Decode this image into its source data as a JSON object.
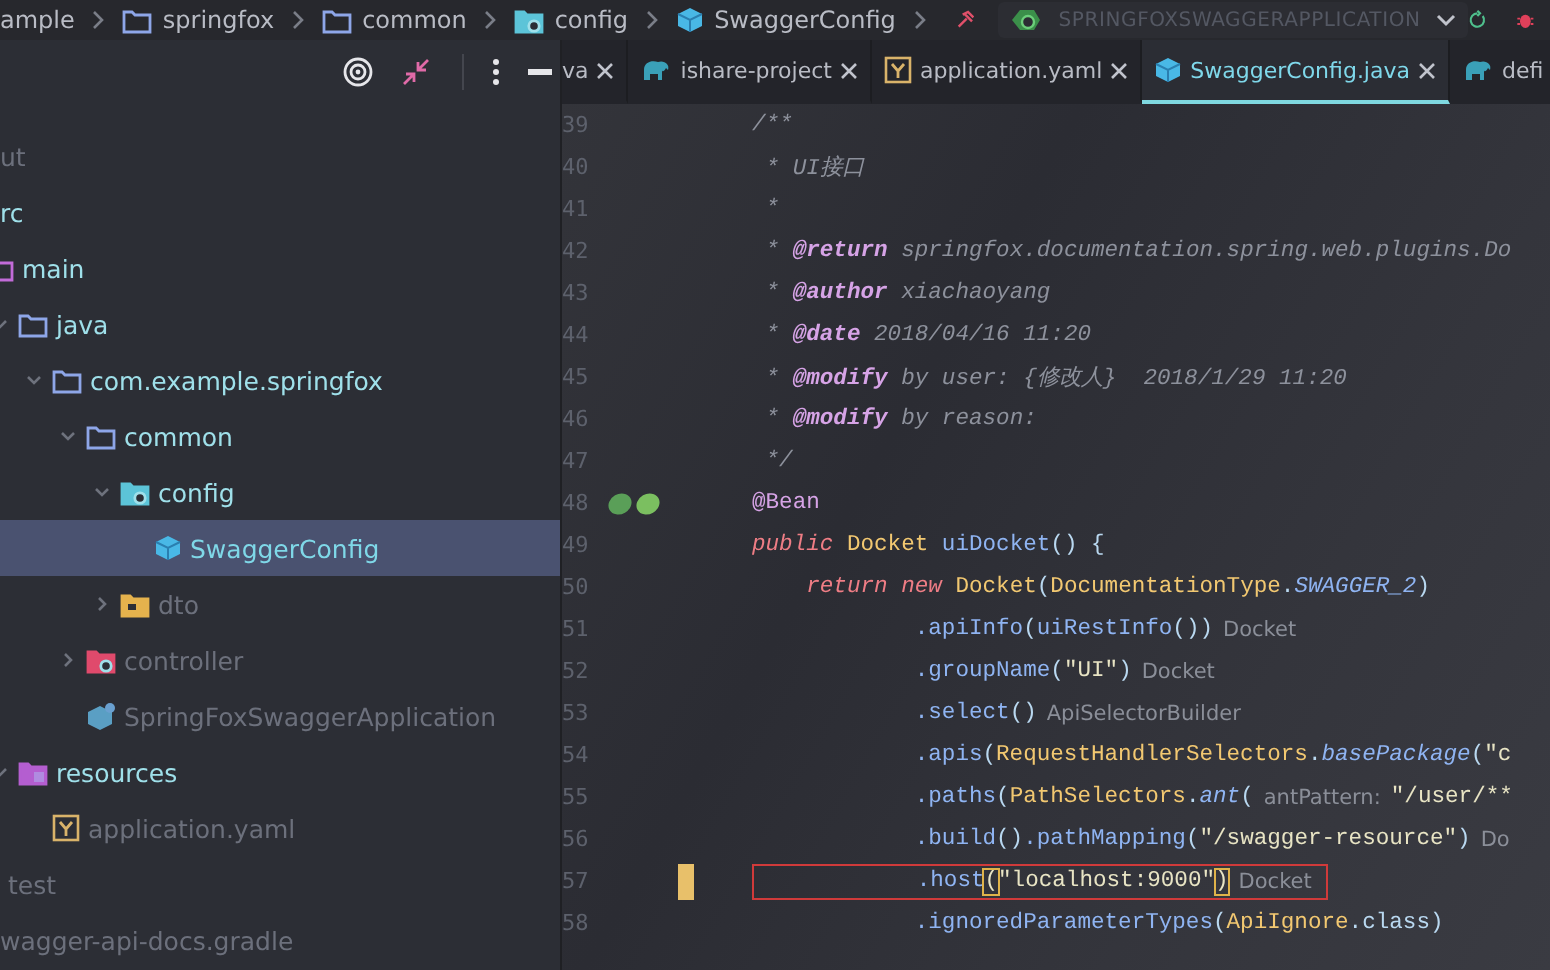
{
  "breadcrumbs": [
    {
      "label": "ample",
      "kind": "none"
    },
    {
      "label": "springfox",
      "kind": "folder"
    },
    {
      "label": "common",
      "kind": "folder"
    },
    {
      "label": "config",
      "kind": "config-folder"
    },
    {
      "label": "SwaggerConfig",
      "kind": "class"
    }
  ],
  "run_config": {
    "label": "SPRINGFOXSWAGGERAPPLICATION"
  },
  "tabs": [
    {
      "label": "va",
      "kind": "none",
      "selected": false
    },
    {
      "label": "ishare-project",
      "kind": "gradle",
      "selected": false
    },
    {
      "label": "application.yaml",
      "kind": "yaml",
      "selected": false
    },
    {
      "label": "SwaggerConfig.java",
      "kind": "class",
      "selected": true
    },
    {
      "label": "defi",
      "kind": "gradle",
      "selected": false
    }
  ],
  "tree": [
    {
      "label": "ut",
      "kind": "none",
      "dimmed": true,
      "selected": false
    },
    {
      "label": "rc",
      "kind": "none",
      "dimmed": false,
      "selected": false,
      "children": [
        {
          "label": "main",
          "kind": "source-folder",
          "dimmed": false,
          "selected": false,
          "children": [
            {
              "label": "java",
              "kind": "folder",
              "expanded": true,
              "dimmed": false,
              "selected": false,
              "children": [
                {
                  "label": "com.example.springfox",
                  "kind": "folder",
                  "expanded": true,
                  "dimmed": false,
                  "selected": false,
                  "children": [
                    {
                      "label": "common",
                      "kind": "folder",
                      "expanded": true,
                      "dimmed": false,
                      "selected": false,
                      "children": [
                        {
                          "label": "config",
                          "kind": "config-folder",
                          "expanded": true,
                          "dimmed": false,
                          "selected": false,
                          "children": [
                            {
                              "label": "SwaggerConfig",
                              "kind": "class",
                              "dimmed": false,
                              "selected": true
                            }
                          ]
                        },
                        {
                          "label": "dto",
                          "kind": "package-folder",
                          "expanded": false,
                          "dimmed": true,
                          "selected": false
                        }
                      ]
                    },
                    {
                      "label": "controller",
                      "kind": "controller-folder",
                      "expanded": false,
                      "dimmed": true,
                      "selected": false
                    },
                    {
                      "label": "SpringFoxSwaggerApplication",
                      "kind": "app-class",
                      "dimmed": true,
                      "selected": false
                    }
                  ]
                }
              ]
            },
            {
              "label": "resources",
              "kind": "resources-folder",
              "expanded": true,
              "dimmed": false,
              "selected": false,
              "children": [
                {
                  "label": "application.yaml",
                  "kind": "yaml",
                  "dimmed": true,
                  "selected": false
                }
              ]
            }
          ]
        },
        {
          "label": "test",
          "kind": "test-folder",
          "dimmed": true,
          "selected": false
        }
      ]
    },
    {
      "label": "wagger-api-docs.gradle",
      "kind": "none",
      "dimmed": true,
      "selected": false
    }
  ],
  "code": [
    {
      "number": "39",
      "parts": [
        {
          "kind": "code",
          "segments": [
            {
              "kind": "comment",
              "text": "/**"
            }
          ]
        }
      ]
    },
    {
      "number": "40",
      "parts": [
        {
          "kind": "code",
          "segments": [
            {
              "kind": "comment",
              "text": " * UI接口"
            }
          ]
        }
      ]
    },
    {
      "number": "41",
      "parts": [
        {
          "kind": "code",
          "segments": [
            {
              "kind": "comment",
              "text": " *"
            }
          ]
        }
      ]
    },
    {
      "number": "42",
      "parts": [
        {
          "kind": "code",
          "segments": [
            {
              "kind": "comment",
              "text": " * "
            },
            {
              "kind": "tag",
              "text": "@return"
            },
            {
              "kind": "comment",
              "text": " springfox.documentation.spring.web.plugins.Do"
            }
          ]
        }
      ]
    },
    {
      "number": "43",
      "parts": [
        {
          "kind": "code",
          "segments": [
            {
              "kind": "comment",
              "text": " * "
            },
            {
              "kind": "tag",
              "text": "@author"
            },
            {
              "kind": "comment",
              "text": " xiachaoyang"
            }
          ]
        }
      ]
    },
    {
      "number": "44",
      "parts": [
        {
          "kind": "code",
          "segments": [
            {
              "kind": "comment",
              "text": " * "
            },
            {
              "kind": "tag",
              "text": "@date"
            },
            {
              "kind": "comment",
              "text": " 2018/04/16 11:20"
            }
          ]
        }
      ]
    },
    {
      "number": "45",
      "parts": [
        {
          "kind": "code",
          "segments": [
            {
              "kind": "comment",
              "text": " * "
            },
            {
              "kind": "tag",
              "text": "@modify"
            },
            {
              "kind": "comment",
              "text": " by user: {修改人}  2018/1/29 11:20"
            }
          ]
        }
      ]
    },
    {
      "number": "46",
      "parts": [
        {
          "kind": "code",
          "segments": [
            {
              "kind": "comment",
              "text": " * "
            },
            {
              "kind": "tag",
              "text": "@modify"
            },
            {
              "kind": "comment",
              "text": " by reason:"
            }
          ]
        }
      ]
    },
    {
      "number": "47",
      "parts": [
        {
          "kind": "code",
          "segments": [
            {
              "kind": "comment",
              "text": " */"
            }
          ]
        }
      ]
    },
    {
      "number": "48",
      "bean_marker": true,
      "parts": [
        {
          "kind": "code",
          "segments": [
            {
              "kind": "annotation",
              "text": "@Bean"
            }
          ]
        }
      ]
    },
    {
      "number": "49",
      "parts": [
        {
          "kind": "code",
          "segments": [
            {
              "kind": "keyword",
              "text": "public"
            },
            {
              "kind": "type",
              "text": " Docket"
            },
            {
              "kind": "method",
              "text": " uiDocket"
            },
            {
              "kind": "punct",
              "text": "() {"
            }
          ]
        }
      ]
    },
    {
      "number": "50",
      "parts": [
        {
          "kind": "code",
          "segments": [
            {
              "kind": "keyword",
              "text": "    return new"
            },
            {
              "kind": "type",
              "text": " Docket"
            },
            {
              "kind": "punct",
              "text": "("
            },
            {
              "kind": "type",
              "text": "DocumentationType"
            },
            {
              "kind": "punct",
              "text": "."
            },
            {
              "kind": "static",
              "text": "SWAGGER_2"
            },
            {
              "kind": "punct",
              "text": ")"
            }
          ]
        }
      ]
    },
    {
      "number": "51",
      "parts": [
        {
          "kind": "code",
          "segments": [
            {
              "kind": "method",
              "text": "            .apiInfo"
            },
            {
              "kind": "punct",
              "text": "("
            },
            {
              "kind": "method",
              "text": "uiRestInfo"
            },
            {
              "kind": "punct",
              "text": "())"
            }
          ]
        },
        {
          "kind": "hint",
          "text": "Docket"
        }
      ]
    },
    {
      "number": "52",
      "parts": [
        {
          "kind": "code",
          "segments": [
            {
              "kind": "method",
              "text": "            .groupName"
            },
            {
              "kind": "punct",
              "text": "("
            },
            {
              "kind": "string",
              "text": "\"UI\""
            },
            {
              "kind": "punct",
              "text": ")"
            }
          ]
        },
        {
          "kind": "hint",
          "text": "Docket"
        }
      ]
    },
    {
      "number": "53",
      "parts": [
        {
          "kind": "code",
          "segments": [
            {
              "kind": "method",
              "text": "            .select"
            },
            {
              "kind": "punct",
              "text": "()"
            }
          ]
        },
        {
          "kind": "hint",
          "text": "ApiSelectorBuilder"
        }
      ]
    },
    {
      "number": "54",
      "parts": [
        {
          "kind": "code",
          "segments": [
            {
              "kind": "method",
              "text": "            .apis"
            },
            {
              "kind": "punct",
              "text": "("
            },
            {
              "kind": "type",
              "text": "RequestHandlerSelectors"
            },
            {
              "kind": "punct",
              "text": "."
            },
            {
              "kind": "static",
              "text": "basePackage"
            },
            {
              "kind": "punct",
              "text": "("
            },
            {
              "kind": "string",
              "text": "\"c"
            }
          ]
        }
      ]
    },
    {
      "number": "55",
      "parts": [
        {
          "kind": "code",
          "segments": [
            {
              "kind": "method",
              "text": "            .paths"
            },
            {
              "kind": "punct",
              "text": "("
            },
            {
              "kind": "type",
              "text": "PathSelectors"
            },
            {
              "kind": "punct",
              "text": "."
            },
            {
              "kind": "static",
              "text": "ant"
            },
            {
              "kind": "punct",
              "text": "("
            }
          ]
        },
        {
          "kind": "hint",
          "text": "antPattern:"
        },
        {
          "kind": "code",
          "segments": [
            {
              "kind": "string",
              "text": "\"/user/**"
            }
          ]
        }
      ]
    },
    {
      "number": "56",
      "parts": [
        {
          "kind": "code",
          "segments": [
            {
              "kind": "method",
              "text": "            .build"
            },
            {
              "kind": "punct",
              "text": "()"
            },
            {
              "kind": "method",
              "text": ".pathMapping"
            },
            {
              "kind": "punct",
              "text": "("
            },
            {
              "kind": "string",
              "text": "\"/swagger-resource\""
            },
            {
              "kind": "punct",
              "text": ")"
            }
          ]
        },
        {
          "kind": "hint",
          "text": "Do"
        }
      ]
    },
    {
      "number": "57",
      "changed": true,
      "boxed": true,
      "parts": [
        {
          "kind": "code",
          "segments": [
            {
              "kind": "method",
              "text": "            .host"
            },
            {
              "kind": "bracket",
              "text": "("
            },
            {
              "kind": "string",
              "text": "\"localhost:9000\""
            },
            {
              "kind": "bracket",
              "text": ")"
            }
          ]
        },
        {
          "kind": "hint",
          "text": "Docket"
        }
      ]
    },
    {
      "number": "58",
      "parts": [
        {
          "kind": "code",
          "segments": [
            {
              "kind": "method",
              "text": "            .ignoredParameterTypes"
            },
            {
              "kind": "punct",
              "text": "("
            },
            {
              "kind": "type",
              "text": "ApiIgnore"
            },
            {
              "kind": "punct",
              "text": ".class)"
            }
          ]
        }
      ]
    }
  ]
}
